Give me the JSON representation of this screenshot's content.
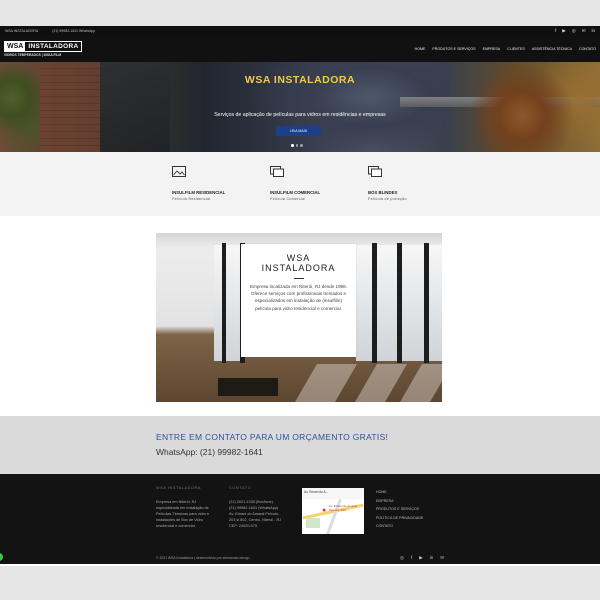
{
  "topbar": {
    "company": "WSA INSTALADORA",
    "phone": "(21) 99982-1641 WhatsApp",
    "social": [
      "f",
      "▶",
      "◎",
      "✉",
      "in"
    ]
  },
  "logo": {
    "wsa": "WSA",
    "instaladora": "INSTALADORA",
    "tagline": "VIDROS TEMPERADOS | INSULFILM"
  },
  "nav": {
    "items": [
      "HOME",
      "PRODUTOS E SERVIÇOS",
      "EMPRESA",
      "CLIENTES",
      "ASSISTÊNCIA TÉCNICA",
      "CONTATO"
    ]
  },
  "hero": {
    "title": "WSA INSTALADORA",
    "text": "Serviços de aplicação de películas para vidros em residências e empresas",
    "button": "LEIA MAIS"
  },
  "services": [
    {
      "title": "INSULFILM RESIDENCIAL",
      "subtitle": "Película Residencial"
    },
    {
      "title": "INSULFILM COMERCIAL",
      "subtitle": "Película Comercial"
    },
    {
      "title": "BOX BLINDEX",
      "subtitle": "Película de proteção"
    }
  ],
  "about": {
    "title_line1": "WSA",
    "title_line2": "INSTALADORA",
    "text": "Empresa localizada em Niterói, RJ desde 1998. Oferece serviços com profissionais treinados e especializados em instalação de (insulfilm) película para vidro residencial e comercial."
  },
  "contact": {
    "headline": "ENTRE EM CONTATO PARA UM ORÇAMENTO GRATIS!",
    "whatsapp": "WhatsApp: (21) 99982-1641"
  },
  "footer": {
    "col1_head": "WSA INSTALADORA",
    "col1_text": "Empresa em Niterói, RJ especializada em instalação de Películas Térmicas para vidro e instalações de Box de Vidro residencial e comercial.",
    "col2_head": "CONTATO",
    "col2_lines": [
      "(21) 2621-1035 (fixo/fone)",
      "(21) 99982-1641 (WhatsApp)",
      "Av. Ernani do Amaral Peixoto,",
      "203 sl 802, Centro, Niterói - RJ",
      "CEP: 24020-075"
    ],
    "map": {
      "place": "Av. Ernani do A...",
      "label": "Av. Ernani do Amaral Peixoto, 203 ..."
    },
    "links": [
      "HOME",
      "EMPRESA",
      "PRODUTOS E SERVIÇOS",
      "POLÍTICA DE PRIVACIDADE",
      "CONTATO"
    ],
    "copyright": "© 2021 WSA Instaladora | desenvolvido por artesanato design",
    "social": [
      "◎",
      "f",
      "▶",
      "in",
      "✉"
    ]
  }
}
